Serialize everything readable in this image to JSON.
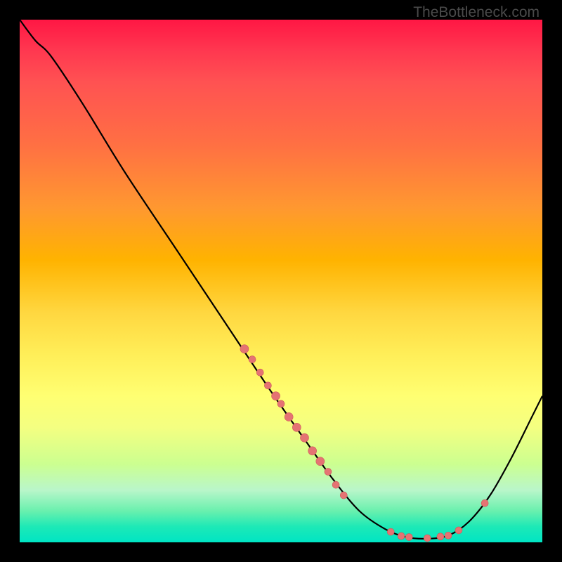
{
  "attribution": "TheBottleneck.com",
  "colors": {
    "dot": "#e57373",
    "dotStroke": "#cc5a5a",
    "curve": "#000000",
    "frame": "#000000"
  },
  "chart_data": {
    "type": "line",
    "title": "",
    "xlabel": "",
    "ylabel": "",
    "xlim": [
      0,
      100
    ],
    "ylim": [
      0,
      100
    ],
    "grid": false,
    "curve": [
      {
        "x": 0,
        "y": 100
      },
      {
        "x": 3,
        "y": 96
      },
      {
        "x": 6,
        "y": 93
      },
      {
        "x": 12,
        "y": 84
      },
      {
        "x": 20,
        "y": 71
      },
      {
        "x": 30,
        "y": 56
      },
      {
        "x": 40,
        "y": 41
      },
      {
        "x": 48,
        "y": 29
      },
      {
        "x": 55,
        "y": 19
      },
      {
        "x": 60,
        "y": 12
      },
      {
        "x": 65,
        "y": 6
      },
      {
        "x": 70,
        "y": 2.5
      },
      {
        "x": 74,
        "y": 1
      },
      {
        "x": 78,
        "y": 0.7
      },
      {
        "x": 82,
        "y": 1.3
      },
      {
        "x": 86,
        "y": 4
      },
      {
        "x": 90,
        "y": 9
      },
      {
        "x": 94,
        "y": 16
      },
      {
        "x": 98,
        "y": 24
      },
      {
        "x": 100,
        "y": 28
      }
    ],
    "curve_dots": [
      {
        "x": 43,
        "y": 37,
        "r": 6
      },
      {
        "x": 44.5,
        "y": 35,
        "r": 5
      },
      {
        "x": 46,
        "y": 32.5,
        "r": 5
      },
      {
        "x": 47.5,
        "y": 30,
        "r": 5
      },
      {
        "x": 49,
        "y": 28,
        "r": 6
      },
      {
        "x": 50,
        "y": 26.5,
        "r": 5
      },
      {
        "x": 51.5,
        "y": 24,
        "r": 6
      },
      {
        "x": 53,
        "y": 22,
        "r": 6
      },
      {
        "x": 54.5,
        "y": 20,
        "r": 6
      },
      {
        "x": 56,
        "y": 17.5,
        "r": 6
      },
      {
        "x": 57.5,
        "y": 15.5,
        "r": 6
      },
      {
        "x": 59,
        "y": 13.5,
        "r": 5
      },
      {
        "x": 60.5,
        "y": 11,
        "r": 5
      },
      {
        "x": 62,
        "y": 9,
        "r": 5
      },
      {
        "x": 71,
        "y": 2,
        "r": 5
      },
      {
        "x": 73,
        "y": 1.2,
        "r": 5
      },
      {
        "x": 74.5,
        "y": 1,
        "r": 5
      },
      {
        "x": 78,
        "y": 0.8,
        "r": 5
      },
      {
        "x": 80.5,
        "y": 1.1,
        "r": 5
      },
      {
        "x": 82,
        "y": 1.3,
        "r": 5
      },
      {
        "x": 84,
        "y": 2.3,
        "r": 5
      },
      {
        "x": 89,
        "y": 7.5,
        "r": 5
      }
    ]
  }
}
